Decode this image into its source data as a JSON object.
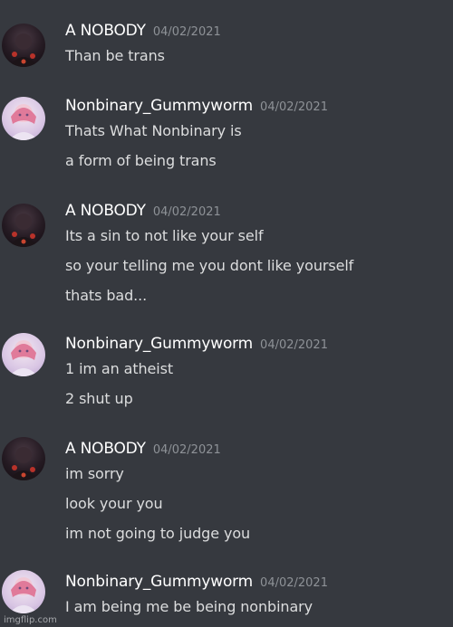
{
  "messages": [
    {
      "username": "A NOBODY",
      "timestamp": "04/02/2021",
      "avatar": "dark",
      "lines": [
        "Than be trans"
      ]
    },
    {
      "username": "Nonbinary_Gummyworm",
      "timestamp": "04/02/2021",
      "avatar": "light",
      "lines": [
        "Thats What Nonbinary is",
        "a form of being trans"
      ]
    },
    {
      "username": "A NOBODY",
      "timestamp": "04/02/2021",
      "avatar": "dark",
      "lines": [
        "Its a sin to not like your self",
        "so your telling me you dont like yourself",
        "thats bad..."
      ]
    },
    {
      "username": "Nonbinary_Gummyworm",
      "timestamp": "04/02/2021",
      "avatar": "light",
      "lines": [
        "1 im an atheist",
        "2 shut up"
      ]
    },
    {
      "username": "A NOBODY",
      "timestamp": "04/02/2021",
      "avatar": "dark",
      "lines": [
        "im sorry",
        "look your you",
        "im not going to judge you"
      ]
    },
    {
      "username": "Nonbinary_Gummyworm",
      "timestamp": "04/02/2021",
      "avatar": "light",
      "lines": [
        "I am being me be being nonbinary"
      ]
    }
  ],
  "watermark": "imgflip.com",
  "colors": {
    "background": "#36393f",
    "username": "#ffffff",
    "timestamp": "#8e9297",
    "message_text": "#dcddde"
  }
}
